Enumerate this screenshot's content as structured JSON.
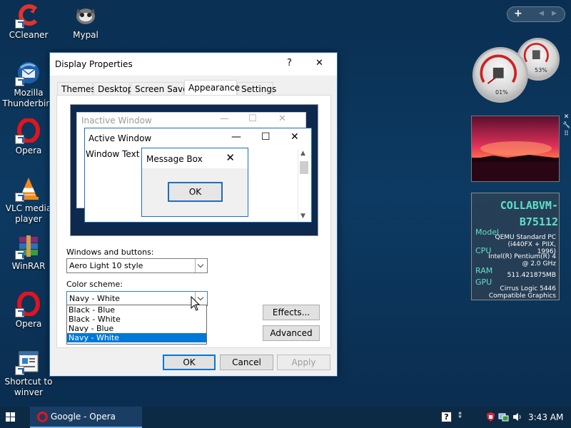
{
  "desktop": {
    "icons": [
      {
        "label": "CCleaner",
        "icon": "ccleaner-icon"
      },
      {
        "label": "Mypal",
        "icon": "mypal-icon"
      },
      {
        "label": "Mozilla Thunderbird",
        "icon": "thunderbird-icon"
      },
      {
        "label": "Opera",
        "icon": "opera-icon"
      },
      {
        "label": "VLC media player",
        "icon": "vlc-icon"
      },
      {
        "label": "WinRAR",
        "icon": "winrar-icon"
      },
      {
        "label": "Opera",
        "icon": "opera-icon"
      },
      {
        "label": "Shortcut to winver",
        "icon": "winver-icon"
      }
    ]
  },
  "dialog": {
    "title": "Display Properties",
    "help_glyph": "?",
    "close_glyph": "✕",
    "tabs": [
      "Themes",
      "Desktop",
      "Screen Saver",
      "Appearance",
      "Settings"
    ],
    "active_tab": "Appearance",
    "preview": {
      "inactive_title": "Inactive Window",
      "active_title": "Active Window",
      "window_text": "Window Text",
      "message_box_title": "Message Box",
      "message_box_ok": "OK"
    },
    "windows_buttons_label": "Windows and buttons:",
    "windows_buttons_value": "Aero Light 10 style",
    "color_scheme_label": "Color scheme:",
    "color_scheme_value": "Navy - White",
    "color_scheme_options": [
      "Black - Blue",
      "Black - White",
      "Navy - Blue",
      "Navy - White"
    ],
    "color_scheme_selected": "Navy - White",
    "effects_button": "Effects...",
    "advanced_button": "Advanced",
    "ok_button": "OK",
    "cancel_button": "Cancel",
    "apply_button": "Apply"
  },
  "taskbar": {
    "task_label": "Google - Opera",
    "clock": "3:43 AM"
  },
  "gadgets": {
    "cpu_gauge_value": "01%",
    "memory_gauge_value": "53%",
    "sysinfo": {
      "hostname": "COLLABVM-B75112",
      "model_label": "Model",
      "model_value": "QEMU Standard PC (i440FX + PIIX, 1996)",
      "cpu_label": "CPU",
      "cpu_value": "Intel(R) Pentium(R) 4 @ 2.0 GHz",
      "ram_label": "RAM",
      "ram_value": "511.421875MB",
      "gpu_label": "GPU",
      "gpu_value": "Cirrus Logic 5446 Compatible Graphics"
    }
  },
  "colors": {
    "desktop_bg": "#0a2f52",
    "accent": "#0078d7",
    "selection": "#0078d7",
    "sysinfo_accent": "#5fe0c8"
  }
}
